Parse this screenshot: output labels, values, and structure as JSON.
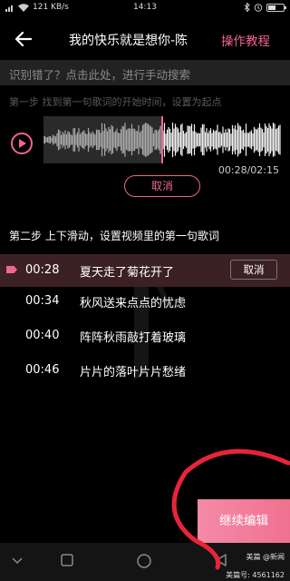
{
  "statusbar": {
    "network": "121 KB/s",
    "time": "14:13"
  },
  "header": {
    "title": "我的快乐就是想你-陈",
    "tutorial_label": "操作教程"
  },
  "search_hint": "识别错了？点击此处，进行手动搜索",
  "step1": {
    "text": "第一步  找到第一句歌词的开始时间，设置为起点"
  },
  "player": {
    "time_display": "00:28/02:15",
    "progress": 0.207,
    "cancel_label": "取消"
  },
  "step2": {
    "text": "第二步  上下滑动，设置视频里的第一句歌词"
  },
  "lyrics": [
    {
      "time": "00:28",
      "text": "夏天走了菊花开了",
      "active": true
    },
    {
      "time": "00:34",
      "text": "秋风送来点点的忧虑",
      "active": false
    },
    {
      "time": "00:40",
      "text": "阵阵秋雨敲打着玻璃",
      "active": false
    },
    {
      "time": "00:46",
      "text": "片片的落叶片片愁绪",
      "active": false
    }
  ],
  "lyric_cancel_label": "取消",
  "continue_label": "继续编辑",
  "watermark": {
    "brand": "美篇",
    "site": "@新闻",
    "id": "美篇号: 4561162"
  },
  "colors": {
    "accent": "#f06592",
    "background": "#000000"
  }
}
